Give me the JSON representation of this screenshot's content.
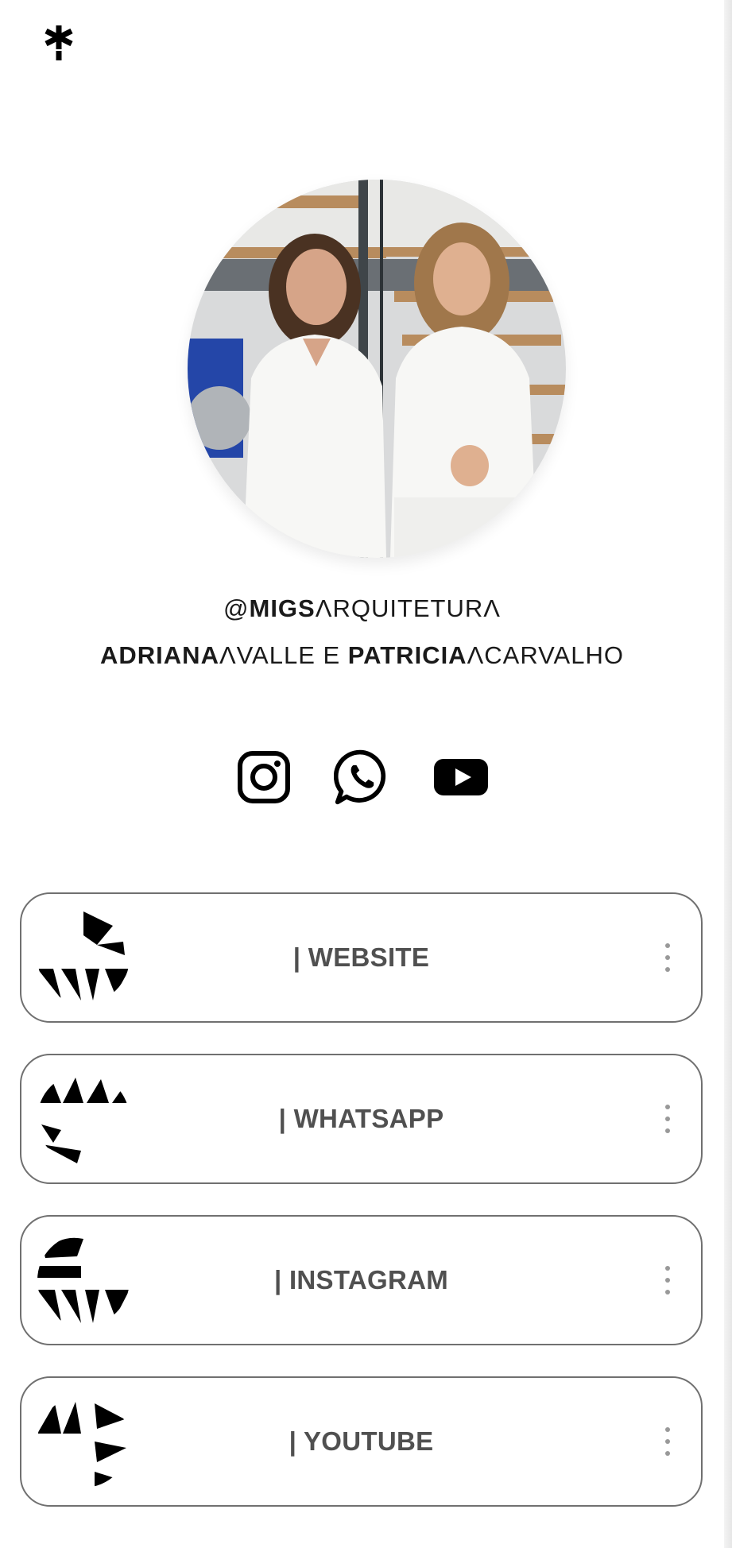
{
  "profile": {
    "handle": {
      "prefix": "@",
      "bold": "MIGS",
      "thin": "ΛRQUITETURΛ"
    },
    "names": {
      "first_bold": "ADRIANA",
      "first_rest": "ΛVALLE E ",
      "second_bold": "PATRICIA",
      "second_rest": "ΛCARVALHO"
    },
    "avatar_icon": "profile-photo"
  },
  "socials": [
    {
      "icon": "instagram-icon"
    },
    {
      "icon": "whatsapp-icon"
    },
    {
      "icon": "youtube-icon"
    }
  ],
  "links": [
    {
      "label": "| WEBSITE"
    },
    {
      "label": "| WHATSAPP"
    },
    {
      "label": "| INSTAGRAM"
    },
    {
      "label": "| YOUTUBE"
    }
  ],
  "colors": {
    "text": "#1a1a1a",
    "border": "#707070",
    "label": "#505050"
  }
}
